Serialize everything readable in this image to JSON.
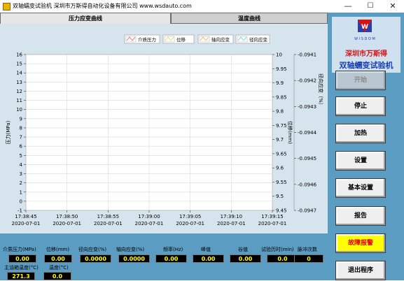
{
  "window": {
    "title": "双轴蠕变试验机    深圳市万斯得自动化设备有限公司    www.wsdauto.com",
    "minimize": "—",
    "maximize": "☐",
    "close": "✕"
  },
  "tabs": [
    {
      "label": "压力应变曲线",
      "active": true
    },
    {
      "label": "温度曲线",
      "active": false
    }
  ],
  "chart_data": {
    "type": "line",
    "series": [
      {
        "name": "介质压力",
        "axis": "left",
        "values": []
      },
      {
        "name": "位移",
        "axis": "right1",
        "values": []
      },
      {
        "name": "轴向应变",
        "axis": "right2",
        "values": []
      },
      {
        "name": "径向应变",
        "axis": "right2",
        "values": []
      }
    ],
    "legend_position": "top-right",
    "grid": true,
    "x_ticks": [
      {
        "time": "17:38:45",
        "date": "2020-07-01"
      },
      {
        "time": "17:38:50",
        "date": "2020-07-01"
      },
      {
        "time": "17:38:55",
        "date": "2020-07-01"
      },
      {
        "time": "17:39:00",
        "date": "2020-07-01"
      },
      {
        "time": "17:39:05",
        "date": "2020-07-01"
      },
      {
        "time": "17:39:10",
        "date": "2020-07-01"
      },
      {
        "time": "17:39:15",
        "date": "2020-07-01"
      }
    ],
    "y_left": {
      "label": "压力(MPa)",
      "ylim": [
        -1,
        16
      ],
      "ticks": [
        "-1",
        "0",
        "1",
        "2",
        "3",
        "4",
        "5",
        "6",
        "7",
        "8",
        "9",
        "10",
        "11",
        "12",
        "13",
        "14",
        "15",
        "16"
      ]
    },
    "y_right1": {
      "label": "位移(mm)",
      "ylim": [
        9.45,
        10
      ],
      "ticks": [
        "9.45",
        "9.5",
        "9.55",
        "9.6",
        "9.65",
        "9.7",
        "9.75",
        "9.8",
        "9.85",
        "9.9",
        "9.95",
        "10"
      ]
    },
    "y_right2": {
      "label": "径向应变（%）",
      "ylim": [
        -0.0947,
        -0.0941
      ],
      "ticks": [
        "-0.0947",
        "-0.0946",
        "-0.0945",
        "-0.0944",
        "-0.0943",
        "-0.0942",
        "-0.0941"
      ]
    }
  },
  "readings": [
    {
      "label": "介质压力(MPa)",
      "value": "0.00"
    },
    {
      "label": "位移(mm)",
      "value": "0.00"
    },
    {
      "label": "径向应变(%)",
      "value": "0.0000"
    },
    {
      "label": "轴向应变(%)",
      "value": "0.0000"
    },
    {
      "label": "频率(Hz)",
      "value": "0.00"
    },
    {
      "label": "峰值",
      "value": "0.00"
    },
    {
      "label": "谷值",
      "value": "0.00"
    },
    {
      "label": "试验历时(min)",
      "value": "0.0"
    },
    {
      "label": "脉冲次数",
      "value": "0"
    },
    {
      "label": "主油箱温度(°C)",
      "value": "271.3"
    },
    {
      "label": "温度(°C)",
      "value": "0.0"
    }
  ],
  "logo": {
    "letters": "W I S D O M",
    "company": "深圳市万斯得",
    "product": "双轴蠕变试验机"
  },
  "buttons": [
    {
      "label": "开始",
      "state": "disabled"
    },
    {
      "label": "停止",
      "state": "normal"
    },
    {
      "label": "加热",
      "state": "normal"
    },
    {
      "label": "设置",
      "state": "normal"
    },
    {
      "label": "基本设置",
      "state": "normal"
    },
    {
      "label": "报告",
      "state": "normal"
    },
    {
      "label": "故障报警",
      "state": "alarm"
    },
    {
      "label": "退出程序",
      "state": "normal"
    }
  ],
  "colors": {
    "panel_blue": "#5b9cc2",
    "readout_bg": "#000000",
    "readout_text": "#ffff00",
    "alarm_bg": "#ffff00",
    "alarm_text": "#e30000",
    "company_red": "#d41414",
    "product_blue": "#1a3fb5"
  }
}
